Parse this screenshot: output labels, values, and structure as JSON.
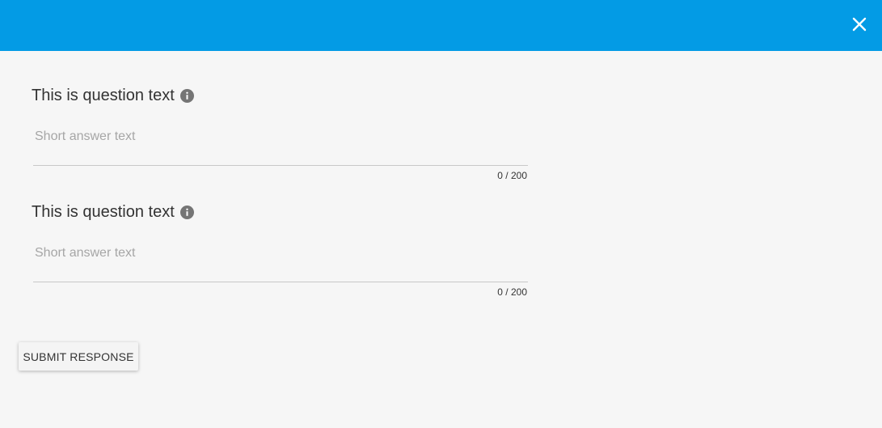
{
  "header": {
    "color": "#039be5",
    "close_icon": "close-icon"
  },
  "questions": [
    {
      "title": "This is question text",
      "info_icon": "info-icon",
      "placeholder": "Short answer text",
      "value": "",
      "counter": "0 / 200"
    },
    {
      "title": "This is question text",
      "info_icon": "info-icon",
      "placeholder": "Short answer text",
      "value": "",
      "counter": "0 / 200"
    }
  ],
  "submit": {
    "label": "SUBMIT RESPONSE"
  }
}
